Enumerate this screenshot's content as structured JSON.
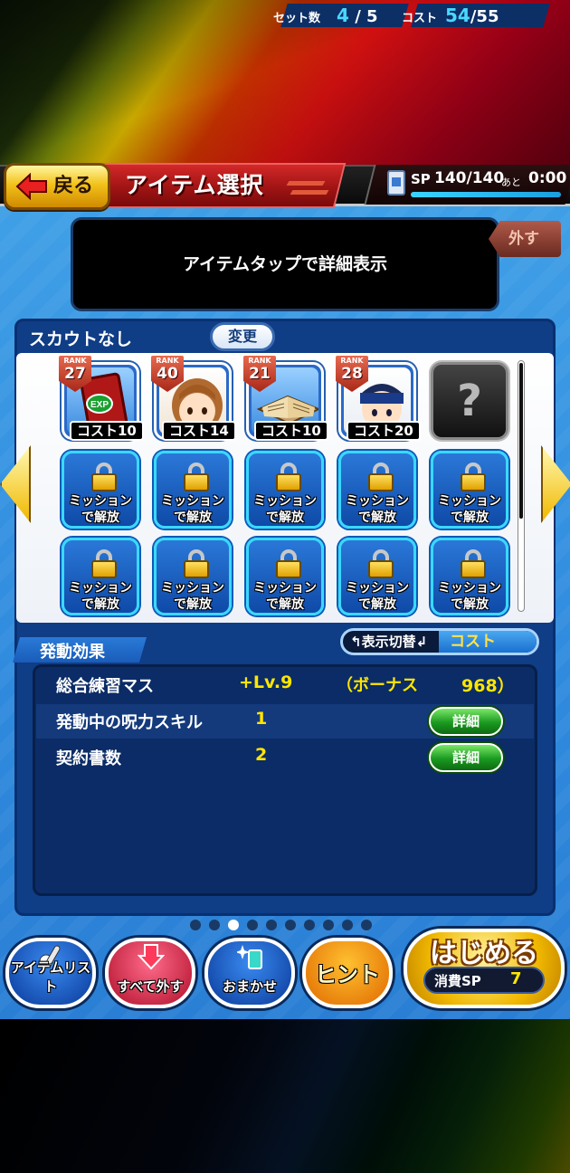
{
  "header": {
    "back_label": "戻る",
    "title": "アイテム選択",
    "sp_label": "SP",
    "sp_value": "140/140",
    "sp_ato": "あと",
    "sp_time": "0:00",
    "sp_fill_fraction": 1.0
  },
  "info": {
    "text": "アイテムタップで詳細表示",
    "remove_label": "外す"
  },
  "scout": {
    "name": "スカウトなし",
    "change_label": "変更",
    "set_label": "セット数",
    "set_current": "4",
    "set_max": "/ 5",
    "cost_label": "コスト",
    "cost_current": "54",
    "cost_max": "/55"
  },
  "items": [
    {
      "rank_label": "RANK",
      "rank": "27",
      "cost": "コスト10",
      "icon": "exp-book-icon"
    },
    {
      "rank_label": "RANK",
      "rank": "40",
      "cost": "コスト14",
      "icon": "female-character-icon"
    },
    {
      "rank_label": "RANK",
      "rank": "21",
      "cost": "コスト10",
      "icon": "open-book-icon"
    },
    {
      "rank_label": "RANK",
      "rank": "28",
      "cost": "コスト20",
      "icon": "male-character-icon"
    }
  ],
  "empty_slot": {
    "mark": "?"
  },
  "locked_slot": {
    "line1": "ミッション",
    "line2": "で解放"
  },
  "effects": {
    "title": "発動効果",
    "toggle_left": "表示切替",
    "toggle_right": "コスト",
    "rows": [
      {
        "label": "総合練習マス",
        "value": "+Lv.9",
        "bonus_open": "（ボーナス",
        "bonus_value": "968）"
      },
      {
        "label": "発動中の呪力スキル",
        "value": "1",
        "detail": "詳細"
      },
      {
        "label": "契約書数",
        "value": "2",
        "detail": "詳細"
      }
    ]
  },
  "pagination": {
    "count": 10,
    "active_index": 2
  },
  "bottom": {
    "item_list": "アイテムリスト",
    "remove_all": "すべて外す",
    "auto": "おまかせ",
    "hint": "ヒント",
    "start": "はじめる",
    "sp_cost_label": "消費SP",
    "sp_cost_value": "7"
  },
  "colors": {
    "accent_cyan": "#4ad8ff",
    "value_yellow": "#ffe600",
    "panel_blue": "#0f3d86"
  }
}
